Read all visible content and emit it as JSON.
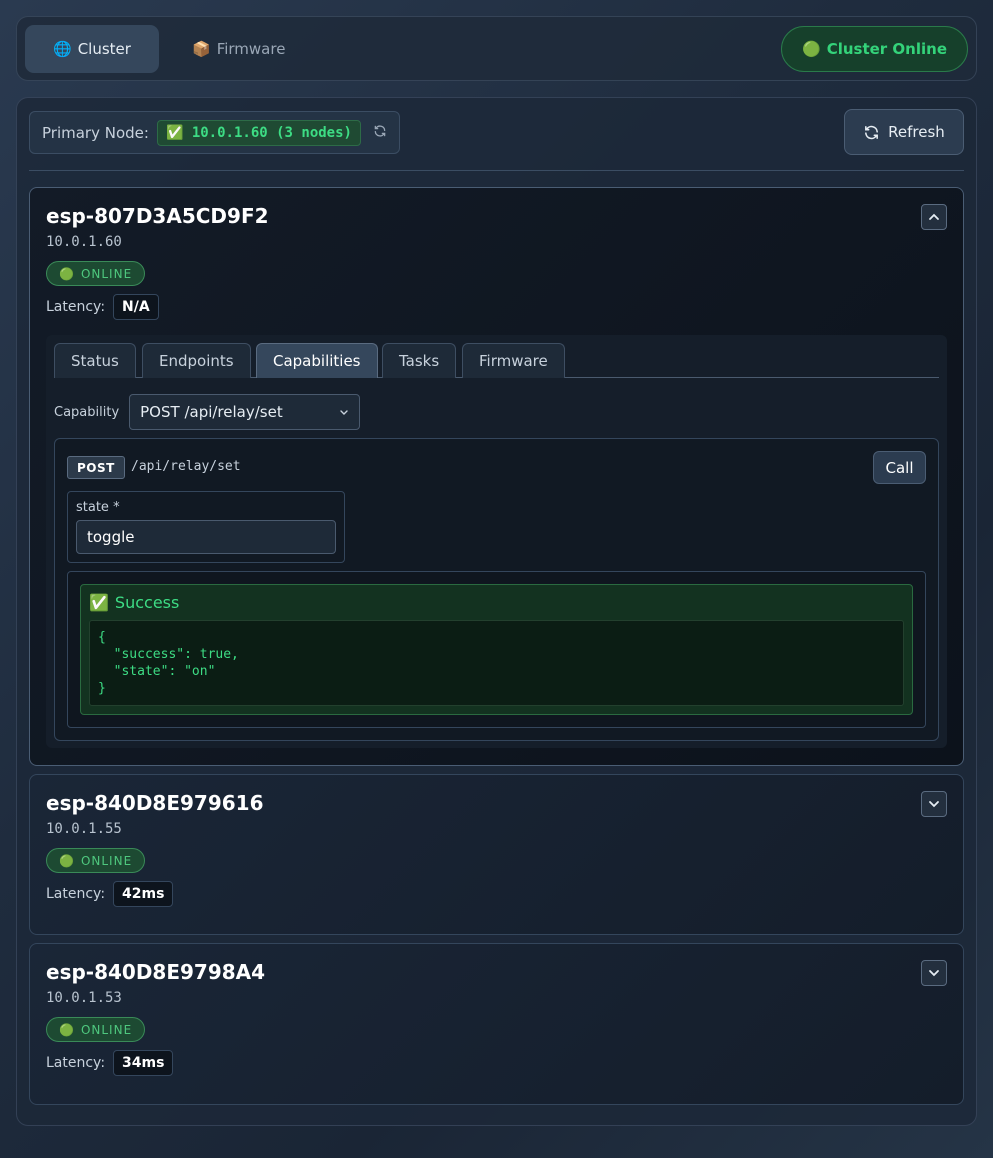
{
  "nav": {
    "tabs": [
      {
        "icon": "🌐",
        "label": "Cluster"
      },
      {
        "icon": "📦",
        "label": "Firmware"
      }
    ],
    "status": {
      "icon": "🟢",
      "label": "Cluster Online"
    }
  },
  "cluster": {
    "primary_label": "Primary Node:",
    "primary_icon": "✅",
    "primary_value": "10.0.1.60 (3 nodes)",
    "refresh_label": "Refresh"
  },
  "nodes": [
    {
      "name": "esp-807D3A5CD9F2",
      "ip": "10.0.1.60",
      "status_icon": "🟢",
      "status": "ONLINE",
      "latency_label": "Latency:",
      "latency": "N/A",
      "expanded": true
    },
    {
      "name": "esp-840D8E979616",
      "ip": "10.0.1.55",
      "status_icon": "🟢",
      "status": "ONLINE",
      "latency_label": "Latency:",
      "latency": "42ms",
      "expanded": false
    },
    {
      "name": "esp-840D8E9798A4",
      "ip": "10.0.1.53",
      "status_icon": "🟢",
      "status": "ONLINE",
      "latency_label": "Latency:",
      "latency": "34ms",
      "expanded": false
    }
  ],
  "detail": {
    "tabs": [
      "Status",
      "Endpoints",
      "Capabilities",
      "Tasks",
      "Firmware"
    ],
    "active_tab": "Capabilities",
    "capability_label": "Capability",
    "capability_selected": "POST /api/relay/set",
    "method": "POST",
    "path": "/api/relay/set",
    "call_label": "Call",
    "param_label": "state *",
    "param_value": "toggle",
    "result_icon": "✅",
    "result_title": "Success",
    "result_body": "{\n  \"success\": true,\n  \"state\": \"on\"\n}"
  },
  "colors": {
    "accent_green": "#3ddc84",
    "online_green": "#4ec77e",
    "panel_bg": "#1c2838"
  }
}
